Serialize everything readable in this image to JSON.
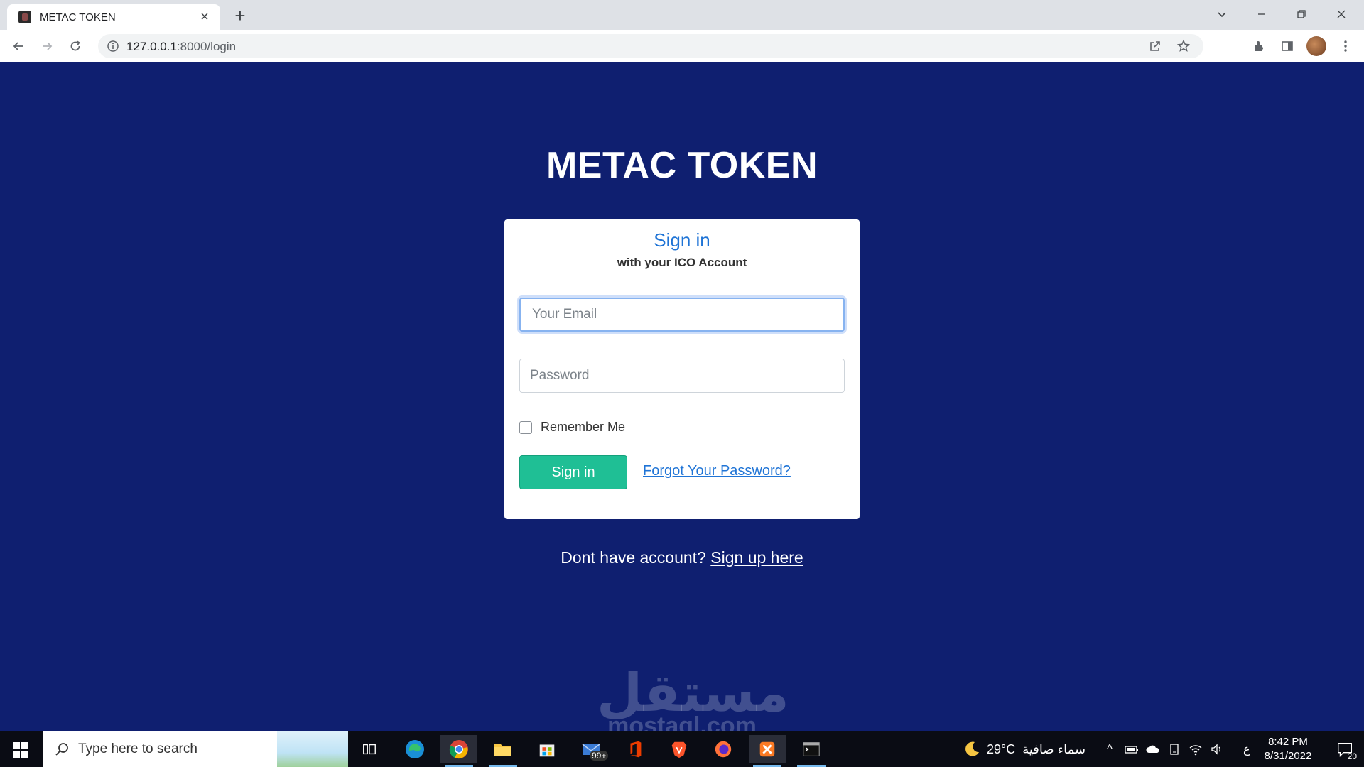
{
  "browser": {
    "tab_title": "METAC TOKEN",
    "new_tab_symbol": "+",
    "url_host": "127.0.0.1",
    "url_path": ":8000/login"
  },
  "page": {
    "brand": "METAC TOKEN",
    "card": {
      "heading": "Sign in",
      "subheading": "with your ICO Account",
      "email_placeholder": "Your Email",
      "password_placeholder": "Password",
      "remember_label": "Remember Me",
      "signin_button": "Sign in",
      "forgot_link": "Forgot Your Password?"
    },
    "signup_prompt": "Dont have account?",
    "signup_link": "Sign up here",
    "watermark": "مستقل",
    "watermark_domain": "mostaql.com"
  },
  "taskbar": {
    "search_placeholder": "Type here to search",
    "mail_badge": "99+",
    "temperature": "29°C",
    "weather_text": "سماء صافية",
    "lang": "ع",
    "time": "8:42 PM",
    "date": "8/31/2022",
    "notification_count": "20"
  },
  "colors": {
    "page_background": "#0f1f70",
    "accent_blue": "#1f74d6",
    "button_green": "#1fbf95"
  }
}
